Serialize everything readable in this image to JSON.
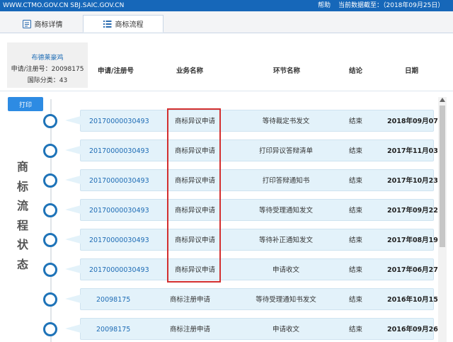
{
  "header": {
    "site": "WWW.CTMO.GOV.CN SBJ.SAIC.GOV.CN",
    "help": "帮助",
    "date_text": "当前数据截至：（2018年09月25日）"
  },
  "tabs": [
    {
      "label": "商标详情",
      "icon": "document-icon",
      "active": false
    },
    {
      "label": "商标流程",
      "icon": "list-icon",
      "active": true
    }
  ],
  "trademark": {
    "name": "布德莱豪鸡",
    "reg_no": "申请/注册号：20098175",
    "intl_class": "国际分类：43"
  },
  "columns": [
    "申请/注册号",
    "业务名称",
    "环节名称",
    "结论",
    "日期"
  ],
  "print_label": "打印",
  "side_title": [
    "商",
    "标",
    "流",
    "程",
    "状",
    "态"
  ],
  "rows": [
    {
      "app_no": "20170000030493",
      "business": "商标异议申请",
      "step": "等待裁定书发文",
      "result": "结束",
      "date": "2018年09月07日"
    },
    {
      "app_no": "20170000030493",
      "business": "商标异议申请",
      "step": "打印异议答辩清单",
      "result": "结束",
      "date": "2017年11月03日"
    },
    {
      "app_no": "20170000030493",
      "business": "商标异议申请",
      "step": "打印答辩通知书",
      "result": "结束",
      "date": "2017年10月23日"
    },
    {
      "app_no": "20170000030493",
      "business": "商标异议申请",
      "step": "等待受理通知发文",
      "result": "结束",
      "date": "2017年09月22日"
    },
    {
      "app_no": "20170000030493",
      "business": "商标异议申请",
      "step": "等待补正通知发文",
      "result": "结束",
      "date": "2017年08月19日"
    },
    {
      "app_no": "20170000030493",
      "business": "商标异议申请",
      "step": "申请收文",
      "result": "结束",
      "date": "2017年06月27日"
    },
    {
      "app_no": "20098175",
      "business": "商标注册申请",
      "step": "等待受理通知书发文",
      "result": "结束",
      "date": "2016年10月15日"
    },
    {
      "app_no": "20098175",
      "business": "商标注册申请",
      "step": "申请收文",
      "result": "结束",
      "date": "2016年09月26日"
    }
  ]
}
